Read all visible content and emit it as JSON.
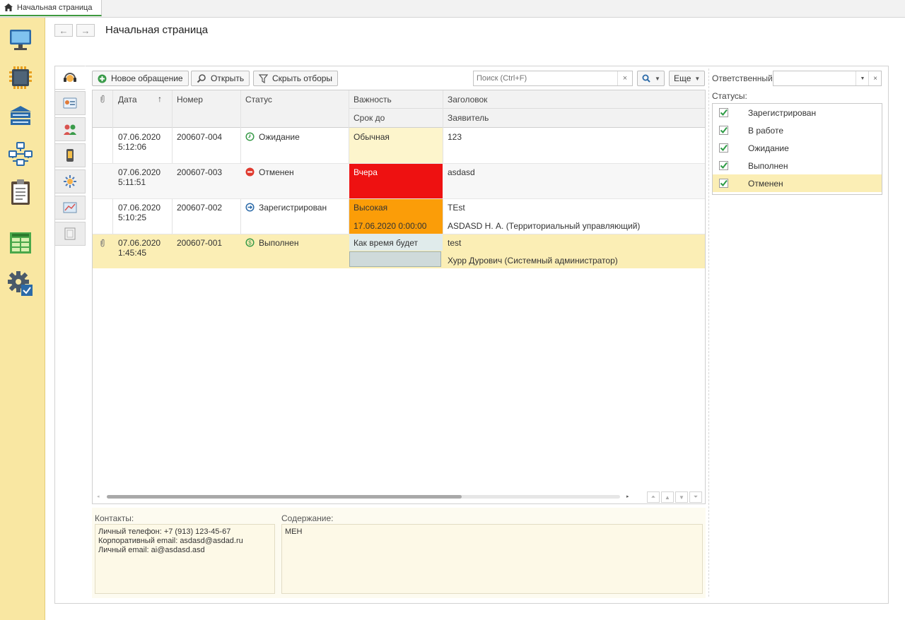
{
  "top_tab": {
    "label": "Начальная страница",
    "icon": "home-icon"
  },
  "sidebar": {
    "items": [
      {
        "name": "desktop",
        "icon": "monitor-icon"
      },
      {
        "name": "chip",
        "icon": "chip-icon"
      },
      {
        "name": "bank",
        "icon": "bank-icon"
      },
      {
        "name": "network",
        "icon": "network-icon"
      },
      {
        "name": "clipboard",
        "icon": "clipboard-icon"
      },
      {
        "name": "table",
        "icon": "table-icon"
      },
      {
        "name": "settings",
        "icon": "gear-icon"
      }
    ]
  },
  "header": {
    "title": "Начальная страница",
    "back_icon": "←",
    "forward_icon": "→"
  },
  "toolbar": {
    "new_request": "Новое обращение",
    "open": "Открыть",
    "hide_filters": "Скрыть отборы",
    "search_placeholder": "Поиск (Ctrl+F)",
    "search_clear": "×",
    "more": "Еще"
  },
  "grid": {
    "headers": {
      "date": "Дата",
      "sort_indicator": "↑",
      "number": "Номер",
      "status": "Статус",
      "importance": "Важность",
      "deadline": "Срок до",
      "subject": "Заголовок",
      "applicant": "Заявитель"
    },
    "rows": [
      {
        "date": "07.06.2020",
        "time": "5:12:06",
        "number": "200607-004",
        "status": "Ожидание",
        "status_icon": "clock-icon",
        "importance": "Обычная",
        "deadline": "",
        "subject": "123",
        "applicant": "",
        "attachment": false
      },
      {
        "date": "07.06.2020",
        "time": "5:11:51",
        "number": "200607-003",
        "status": "Отменен",
        "status_icon": "stop-icon",
        "importance": "Вчера",
        "deadline": "",
        "subject": "asdasd",
        "applicant": "",
        "attachment": false
      },
      {
        "date": "07.06.2020",
        "time": "5:10:25",
        "number": "200607-002",
        "status": "Зарегистрирован",
        "status_icon": "arrow-circle-icon",
        "importance": "Высокая",
        "deadline": "17.06.2020 0:00:00",
        "subject": "TEst",
        "applicant": "ASDASD Н. А. (Территориальный управляющий)",
        "attachment": false
      },
      {
        "date": "07.06.2020",
        "time": "1:45:45",
        "number": "200607-001",
        "status": "Выполнен",
        "status_icon": "dollar-circle-icon",
        "importance": "Как время будет",
        "deadline": "",
        "subject": "test",
        "applicant": "Хурр Дурович (Системный администратор)",
        "attachment": true
      }
    ]
  },
  "filters": {
    "responsible_label": "Ответственный:",
    "responsible_value": "",
    "statuses_label": "Статусы:",
    "statuses": [
      {
        "label": "Зарегистрирован",
        "checked": true
      },
      {
        "label": "В работе",
        "checked": true
      },
      {
        "label": "Ожидание",
        "checked": true
      },
      {
        "label": "Выполнен",
        "checked": true
      },
      {
        "label": "Отменен",
        "checked": true,
        "selected": true
      }
    ]
  },
  "details": {
    "contacts_label": "Контакты:",
    "contacts_lines": [
      "Личный телефон: +7 (913) 123-45-67",
      "Корпоративный email: asdasd@asdad.ru",
      "Личный email: ai@asdasd.asd"
    ],
    "content_label": "Содержание:",
    "content_text": "МЕН"
  },
  "colors": {
    "sidebar_bg": "#f9e7a2",
    "importance_normal": "#fdf5cc",
    "importance_yesterday": "#ee1111",
    "importance_high": "#fb9d08",
    "importance_whenever": "#e0ebeb",
    "selected_row": "#fbeeb5",
    "checkbox_green": "#2e9b45"
  }
}
